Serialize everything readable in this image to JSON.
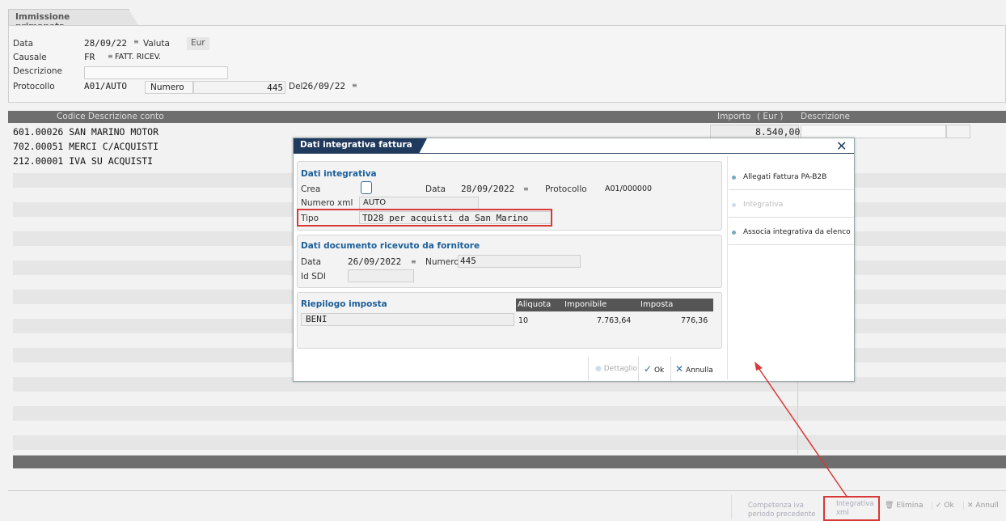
{
  "window": {
    "tab_title": "Immissione primanota"
  },
  "header": {
    "data_label": "Data",
    "data_value": "28/09/22",
    "valuta_label": "Valuta",
    "valuta_value": "Eur",
    "causale_label": "Causale",
    "causale_code": "FR",
    "causale_desc": "FATT. RICEV.",
    "descrizione_label": "Descrizione",
    "protocollo_label": "Protocollo",
    "protocollo_value": "A01/AUTO",
    "numero_label": "Numero",
    "numero_value": "445",
    "del_label": "Del",
    "del_value": "26/09/22"
  },
  "grid": {
    "col_codice": "Codice Descrizione conto",
    "col_importo": "Importo",
    "col_eur": "( Eur )",
    "col_descrizione": "Descrizione",
    "rows": [
      {
        "text": "601.00026 SAN MARINO MOTOR",
        "importo": "8.540,00A"
      },
      {
        "text": "702.00051 MERCI C/ACQUISTI"
      },
      {
        "text": "212.00001 IVA SU ACQUISTI"
      }
    ]
  },
  "modal": {
    "title": "Dati integrativa fattura",
    "sec1_title": "Dati integrativa",
    "crea_label": "Crea",
    "data_label": "Data",
    "data_value": "28/09/2022",
    "protocollo_label": "Protocollo",
    "protocollo_value": "A01/000000",
    "numero_xml_label": "Numero xml",
    "numero_xml_value": "AUTO",
    "tipo_label": "Tipo",
    "tipo_value": "TD28 per acquisti da San Marino",
    "sec2_title": "Dati documento ricevuto da fornitore",
    "doc_data_label": "Data",
    "doc_data_value": "26/09/2022",
    "doc_numero_label": "Numero",
    "doc_numero_value": "445",
    "idsdi_label": "Id SDI",
    "sec3_title": "Riepilogo imposta",
    "riepilogo_headers": [
      "Aliquota",
      "Imponibile",
      "Imposta"
    ],
    "riepilogo_row": {
      "desc": "BENI",
      "aliquota": "10",
      "imponibile": "7.763,64",
      "imposta": "776,36"
    },
    "side": {
      "allegati": "Allegati Fattura PA-B2B",
      "integrativa": "Integrativa",
      "associa": "Associa integrativa da elenco"
    },
    "btn_dettaglio": "Dettaglio",
    "btn_ok": "Ok",
    "btn_annulla": "Annulla"
  },
  "footer": {
    "competenza": "Competenza iva periodo precedente",
    "integrativa_xml": "Integrativa xml",
    "elimina": "Elimina",
    "ok": "Ok",
    "annulla": "Annull"
  }
}
